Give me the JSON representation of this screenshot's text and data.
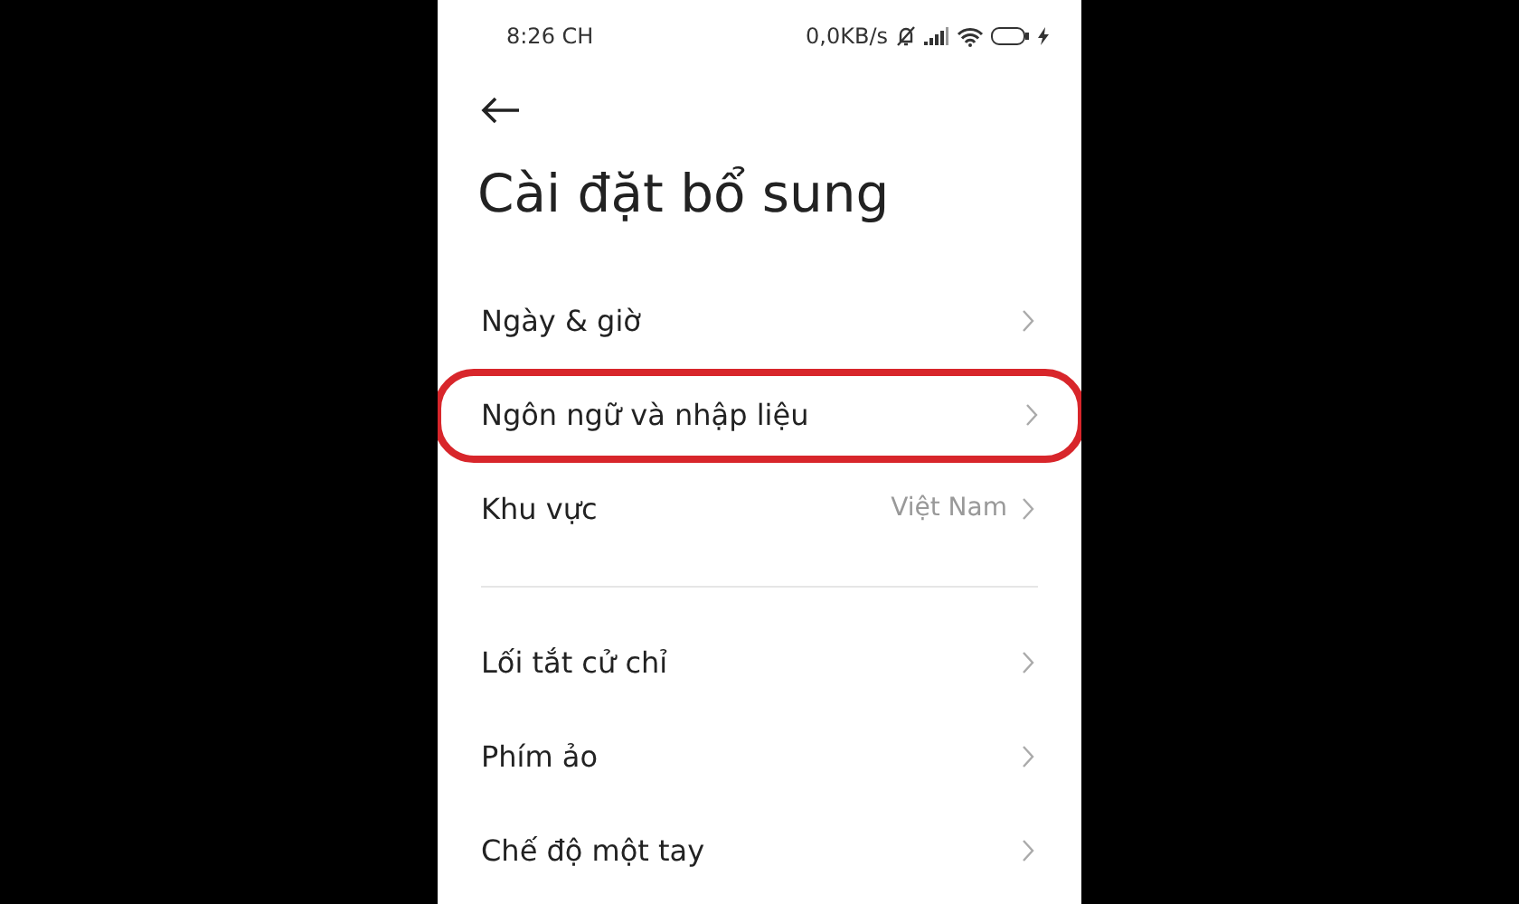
{
  "status_bar": {
    "time": "8:26 CH",
    "speed": "0,0KB/s",
    "charging": true
  },
  "title": "Cài đặt bổ sung",
  "sections": [
    {
      "items": [
        {
          "label": "Ngày & giờ",
          "highlighted": false
        },
        {
          "label": "Ngôn ngữ và nhập liệu",
          "highlighted": true
        },
        {
          "label": "Khu vực",
          "value": "Việt Nam",
          "highlighted": false
        }
      ]
    },
    {
      "items": [
        {
          "label": "Lối tắt cử chỉ",
          "highlighted": false
        },
        {
          "label": "Phím ảo",
          "highlighted": false
        },
        {
          "label": "Chế độ một tay",
          "highlighted": false
        }
      ]
    }
  ]
}
